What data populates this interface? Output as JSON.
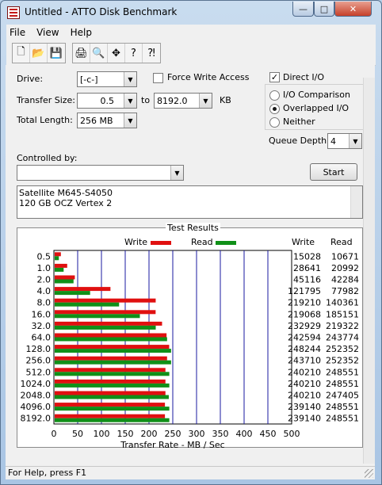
{
  "window": {
    "title": "Untitled - ATTO Disk Benchmark",
    "min": "—",
    "max": "□",
    "close": "✕"
  },
  "menu": [
    "File",
    "View",
    "Help"
  ],
  "toolbar": {
    "group1": [
      "new-file-icon",
      "open-folder-icon",
      "save-icon"
    ],
    "group2": [
      "print-icon",
      "print-preview-icon",
      "move-icon",
      "help-icon",
      "context-help-icon"
    ],
    "glyphs": {
      "new-file-icon": "🗋",
      "open-folder-icon": "📂",
      "save-icon": "💾",
      "print-icon": "🖨",
      "print-preview-icon": "🔍",
      "move-icon": "✥",
      "help-icon": "?",
      "context-help-icon": "⁈"
    }
  },
  "form": {
    "drive_label": "Drive:",
    "drive_value": "[-c-]",
    "transfer_size_label": "Transfer Size:",
    "transfer_from": "0.5",
    "transfer_to_label": "to",
    "transfer_to": "8192.0",
    "transfer_unit": "KB",
    "total_length_label": "Total Length:",
    "total_length": "256 MB",
    "force_write_label": "Force Write Access",
    "force_write_checked": false,
    "direct_io_label": "Direct I/O",
    "direct_io_checked": true,
    "io_options": [
      {
        "label": "I/O Comparison",
        "selected": false
      },
      {
        "label": "Overlapped I/O",
        "selected": true
      },
      {
        "label": "Neither",
        "selected": false
      }
    ],
    "queue_depth_label": "Queue Depth:",
    "queue_depth": "4",
    "controlled_by_label": "Controlled by:",
    "controlled_by": "",
    "start_label": "Start",
    "description_lines": [
      "Satellite M645-S4050",
      "120 GB OCZ Vertex 2"
    ]
  },
  "results": {
    "title": "Test Results",
    "legend_write": "Write",
    "legend_read": "Read",
    "col_write": "Write",
    "col_read": "Read",
    "write_color": "#e01010",
    "read_color": "#109018",
    "grid_color": "#1a1aa0"
  },
  "chart_data": {
    "type": "bar",
    "title": "Test Results",
    "xlabel": "Transfer Rate - MB / Sec",
    "xlim": [
      0,
      500
    ],
    "xticks": [
      0,
      50,
      100,
      150,
      200,
      250,
      300,
      350,
      400,
      450,
      500
    ],
    "categories": [
      "0.5",
      "1.0",
      "2.0",
      "4.0",
      "8.0",
      "16.0",
      "32.0",
      "64.0",
      "128.0",
      "256.0",
      "512.0",
      "1024.0",
      "2048.0",
      "4096.0",
      "8192.0"
    ],
    "series": [
      {
        "name": "Write",
        "values_kb": [
          15028,
          28641,
          45116,
          121795,
          219210,
          219068,
          232929,
          242594,
          248244,
          243710,
          240210,
          240210,
          240210,
          239140,
          239140
        ]
      },
      {
        "name": "Read",
        "values_kb": [
          10671,
          20992,
          42284,
          77982,
          140361,
          185151,
          219322,
          243774,
          252352,
          252352,
          248551,
          248551,
          247405,
          248551,
          248551
        ]
      }
    ]
  },
  "statusbar": {
    "text": "For Help, press F1"
  }
}
